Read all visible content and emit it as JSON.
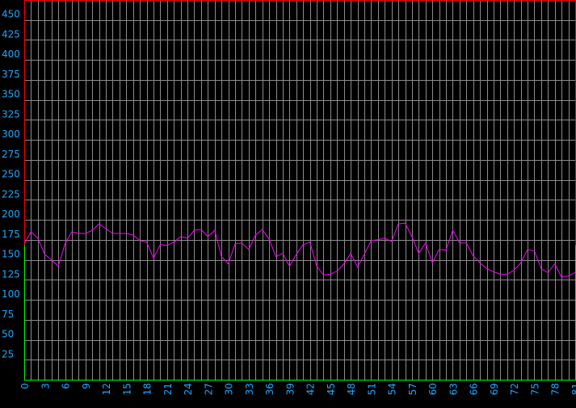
{
  "chart_data": {
    "type": "line",
    "grid": true,
    "ylim": [
      0,
      475
    ],
    "xlim": [
      0,
      81
    ],
    "yticks": [
      25,
      50,
      75,
      100,
      125,
      150,
      175,
      200,
      225,
      250,
      275,
      300,
      325,
      350,
      375,
      400,
      425,
      450
    ],
    "xticks": [
      0,
      3,
      6,
      9,
      12,
      15,
      18,
      21,
      24,
      27,
      30,
      33,
      36,
      39,
      42,
      45,
      48,
      51,
      54,
      57,
      60,
      63,
      66,
      69,
      72,
      75,
      78,
      81
    ],
    "series": [
      {
        "color": "#ff00ff",
        "x": [
          0,
          1,
          2,
          3,
          4,
          5,
          6,
          7,
          8,
          9,
          10,
          11,
          12,
          13,
          14,
          15,
          16,
          17,
          18,
          19,
          20,
          21,
          22,
          23,
          24,
          25,
          26,
          27,
          28,
          29,
          30,
          31,
          32,
          33,
          34,
          35,
          36,
          37,
          38,
          39,
          40,
          41,
          42,
          43,
          44,
          45,
          46,
          47,
          48,
          49,
          50,
          51,
          52,
          53,
          54,
          55,
          56,
          57,
          58,
          59,
          60,
          61,
          62,
          63,
          64,
          65,
          66,
          67,
          68,
          69,
          70,
          71,
          72,
          73,
          74,
          75,
          76,
          77,
          78,
          79,
          80,
          81
        ],
        "values": [
          170,
          185,
          177,
          157,
          150,
          142,
          170,
          185,
          183,
          183,
          187,
          195,
          189,
          183,
          183,
          183,
          181,
          174,
          172,
          152,
          169,
          168,
          172,
          179,
          177,
          187,
          188,
          179,
          187,
          154,
          145,
          170,
          171,
          163,
          181,
          188,
          176,
          154,
          158,
          142,
          157,
          169,
          172,
          142,
          131,
          132,
          136,
          145,
          158,
          141,
          157,
          174,
          175,
          177,
          173,
          195,
          196,
          179,
          158,
          171,
          146,
          163,
          162,
          187,
          171,
          171,
          155,
          146,
          139,
          135,
          132,
          132,
          137,
          146,
          163,
          161,
          139,
          134,
          145,
          128,
          130,
          134
        ]
      }
    ],
    "colors": {
      "background": "#000000",
      "grid": "#8c8c8c",
      "tick_label": "#1ea8ff",
      "upper_frame": "#ff0000",
      "lower_frame": "#00ff00"
    }
  }
}
